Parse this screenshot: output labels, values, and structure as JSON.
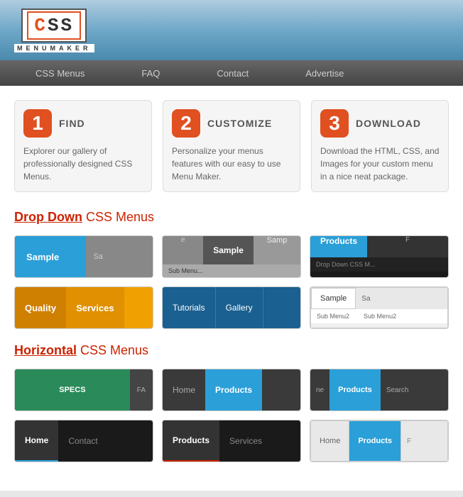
{
  "header": {
    "logo_text": "CSS",
    "logo_sub": "MENUMAKER"
  },
  "nav": {
    "items": [
      {
        "label": "CSS Menus"
      },
      {
        "label": "FAQ"
      },
      {
        "label": "Contact"
      },
      {
        "label": "Advertise"
      }
    ]
  },
  "steps": [
    {
      "number": "1",
      "title": "FIND",
      "description": "Explorer our gallery of professionally designed CSS Menus."
    },
    {
      "number": "2",
      "title": "CUSTOMIZE",
      "description": "Personalize your menus features with our easy to use Menu Maker."
    },
    {
      "number": "3",
      "title": "DOWNLOAD",
      "description": "Download the HTML, CSS, and Images for your custom menu in a nice neat package."
    }
  ],
  "dropdown_section": {
    "title_highlight": "Drop Down",
    "title_rest": " CSS Menus"
  },
  "horizontal_section": {
    "title_highlight": "Horizontal",
    "title_rest": " CSS Menus"
  },
  "menus": {
    "dropdown": [
      {
        "type": "blue-sample",
        "label": "Sample"
      },
      {
        "type": "gray-sample",
        "label": "Sample"
      },
      {
        "type": "products-dark",
        "label": "Products"
      },
      {
        "type": "quality",
        "labels": [
          "Quality",
          "Services"
        ]
      },
      {
        "type": "tutorials",
        "labels": [
          "Tutorials",
          "Gallery"
        ]
      },
      {
        "type": "sample-sub",
        "label": "Sample",
        "sub": [
          "Sub Menu2",
          "Sub Menu2"
        ]
      }
    ],
    "horizontal": [
      {
        "type": "specs",
        "label": "SPECS",
        "side": "FA"
      },
      {
        "type": "home-products",
        "labels": [
          "Home",
          "Products"
        ]
      },
      {
        "type": "search",
        "labels": [
          "ne",
          "Products",
          "Search"
        ]
      },
      {
        "type": "home-contact",
        "labels": [
          "Home",
          "Contact"
        ]
      },
      {
        "type": "prod-services",
        "labels": [
          "Products",
          "Services"
        ]
      },
      {
        "type": "home-prod2",
        "labels": [
          "Home",
          "Products",
          "F"
        ]
      }
    ]
  }
}
